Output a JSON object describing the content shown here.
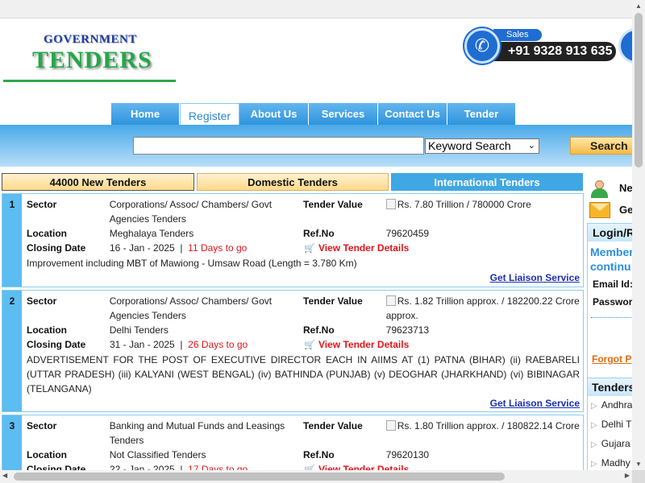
{
  "logo": {
    "line1": "GOVERNMENT",
    "line2": "TENDERS"
  },
  "sales": {
    "label": "Sales",
    "phone": "+91 9328 913 635",
    "icon": "phone-icon"
  },
  "nav": [
    {
      "label": "Home",
      "active": false
    },
    {
      "label": "Register",
      "active": true
    },
    {
      "label": "About Us",
      "active": false
    },
    {
      "label": "Services",
      "active": false
    },
    {
      "label": "Contact Us",
      "active": false
    },
    {
      "label": "Tender",
      "active": false
    }
  ],
  "search": {
    "input_value": "",
    "select_value": "Keyword Search",
    "button_label": "Search"
  },
  "tender_tabs": [
    {
      "label": "44000 New Tenders"
    },
    {
      "label": "Domestic Tenders"
    },
    {
      "label": "International Tenders"
    }
  ],
  "labels": {
    "sector": "Sector",
    "location": "Location",
    "closing": "Closing Date",
    "tender_value": "Tender Value",
    "refno": "Ref.No",
    "view": "View Tender Details",
    "liaison": "Get Liaison Service"
  },
  "tenders": [
    {
      "num": "1",
      "sector": "Corporations/ Assoc/ Chambers/ Govt Agencies Tenders",
      "value": "Rs. 7.80 Trillion / 780000 Crore",
      "location": "Meghalaya Tenders",
      "ref": "79620459",
      "date": "16 - Jan - 2025",
      "days": "11 Days to go",
      "desc": "Improvement including MBT of Mawiong - Umsaw Road (Length = 3.780 Km)"
    },
    {
      "num": "2",
      "sector": "Corporations/ Assoc/ Chambers/ Govt Agencies Tenders",
      "value": "Rs. 1.82 Trillion approx. / 182200.22 Crore approx.",
      "location": "Delhi Tenders",
      "ref": "79623713",
      "date": "31 - Jan - 2025",
      "days": "26 Days to go",
      "desc": "ADVERTISEMENT FOR THE POST OF EXECUTIVE DIRECTOR EACH IN AIIMS AT (1) PATNA (BIHAR) (ii) RAEBARELI (UTTAR PRADESH) (iii) KALYANI (WEST BENGAL) (iv) BATHINDA (PUNJAB) (v) DEOGHAR (JHARKHAND) (vi) BIBINAGAR (TELANGANA)"
    },
    {
      "num": "3",
      "sector": "Banking and Mutual Funds and Leasings Tenders",
      "value": "Rs. 1.80 Trillion approx. / 180822.14 Crore",
      "location": "Not Classified Tenders",
      "ref": "79620130",
      "date": "22 - Jan - 2025",
      "days": "17 Days to go",
      "desc": ""
    }
  ],
  "sidebar": {
    "new_label": "Ne",
    "get_label": "Ge",
    "login_title": "Login/R",
    "member_line1": "Member",
    "member_line2": "continu",
    "email_label": "Email Id:",
    "password_label": "Passwor",
    "forgot": "Forgot P",
    "tenders_title": "Tenders",
    "states": [
      "Andhra",
      "Delhi T",
      "Gujara",
      "Madhy"
    ]
  }
}
